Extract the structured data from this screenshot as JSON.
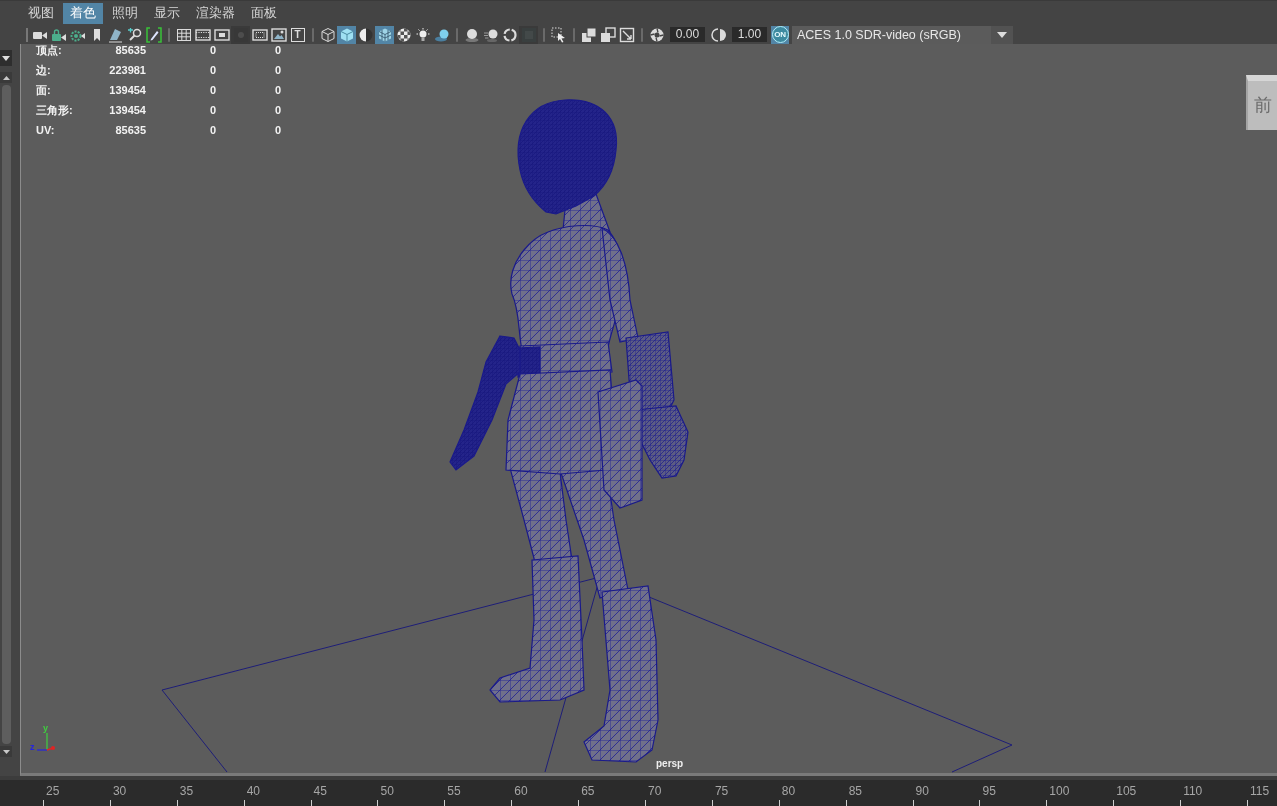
{
  "menu": [
    {
      "label": "视图",
      "selected": false
    },
    {
      "label": "着色",
      "selected": true
    },
    {
      "label": "照明",
      "selected": false
    },
    {
      "label": "显示",
      "selected": false
    },
    {
      "label": "渲染器",
      "selected": false
    },
    {
      "label": "面板",
      "selected": false
    }
  ],
  "toolbar": {
    "groups": [
      {
        "items": [
          {
            "kind": "tool",
            "on": false,
            "disabled": false
          },
          {
            "kind": "tool",
            "on": false,
            "disabled": false
          },
          {
            "kind": "tool",
            "on": false,
            "disabled": false
          },
          {
            "kind": "tool",
            "on": false,
            "disabled": false
          },
          {
            "kind": "tool",
            "on": false,
            "disabled": false
          },
          {
            "kind": "tool",
            "on": false,
            "disabled": false
          },
          {
            "kind": "tool",
            "on": false,
            "disabled": false
          }
        ]
      },
      {
        "items": [
          {
            "kind": "tool",
            "on": false,
            "disabled": false
          },
          {
            "kind": "tool",
            "on": false,
            "disabled": false
          },
          {
            "kind": "tool",
            "on": false,
            "disabled": false
          },
          {
            "kind": "tool",
            "on": false,
            "disabled": true
          },
          {
            "kind": "tool",
            "on": false,
            "disabled": false
          },
          {
            "kind": "tool",
            "on": false,
            "disabled": false
          },
          {
            "kind": "tool",
            "glyph": "T",
            "on": false,
            "disabled": false
          }
        ]
      },
      {
        "items": [
          {
            "kind": "tool",
            "on": false,
            "disabled": false
          },
          {
            "kind": "tool",
            "on": true,
            "disabled": false
          },
          {
            "kind": "tool",
            "on": false,
            "disabled": false
          },
          {
            "kind": "tool",
            "on": true,
            "disabled": false
          },
          {
            "kind": "tool",
            "on": false,
            "disabled": false
          },
          {
            "kind": "tool",
            "on": false,
            "disabled": false
          },
          {
            "kind": "tool",
            "on": false,
            "disabled": false
          }
        ]
      },
      {
        "items": [
          {
            "kind": "tool",
            "on": false,
            "disabled": false
          },
          {
            "kind": "tool",
            "on": false,
            "disabled": false
          },
          {
            "kind": "tool",
            "on": false,
            "disabled": false
          },
          {
            "kind": "tool",
            "on": false,
            "disabled": true
          }
        ]
      },
      {
        "items": [
          {
            "kind": "tool",
            "on": false,
            "disabled": false
          }
        ]
      },
      {
        "items": [
          {
            "kind": "tool",
            "on": false,
            "disabled": false
          },
          {
            "kind": "tool",
            "on": false,
            "disabled": false
          },
          {
            "kind": "tool",
            "on": false,
            "disabled": false
          }
        ]
      },
      {
        "items": [
          {
            "kind": "tool",
            "on": false,
            "disabled": false
          },
          {
            "kind": "field",
            "value": "0.00"
          },
          {
            "kind": "tool",
            "on": false,
            "disabled": false
          },
          {
            "kind": "field",
            "value": "1.00"
          },
          {
            "kind": "toggle",
            "label": "ON",
            "on": true
          },
          {
            "kind": "dropdown",
            "value": "ACES 1.0 SDR-video (sRGB)"
          }
        ]
      }
    ]
  },
  "viewport": {
    "hud": [
      {
        "label": "顶点:",
        "values": [
          "85635",
          "0",
          "0"
        ]
      },
      {
        "label": "边:",
        "values": [
          "223981",
          "0",
          "0"
        ]
      },
      {
        "label": "面:",
        "values": [
          "139454",
          "0",
          "0"
        ]
      },
      {
        "label": "三角形:",
        "values": [
          "139454",
          "0",
          "0"
        ]
      },
      {
        "label": "UV:",
        "values": [
          "85635",
          "0",
          "0"
        ]
      }
    ],
    "view_cube": {
      "label": "前"
    },
    "camera": "persp",
    "axis_labels": [
      "y",
      "z"
    ]
  },
  "timeline": {
    "frames": [
      "25",
      "30",
      "35",
      "40",
      "45",
      "50",
      "55",
      "60",
      "65",
      "70",
      "75",
      "80",
      "85",
      "90",
      "95",
      "100",
      "105",
      "110",
      "115"
    ]
  }
}
